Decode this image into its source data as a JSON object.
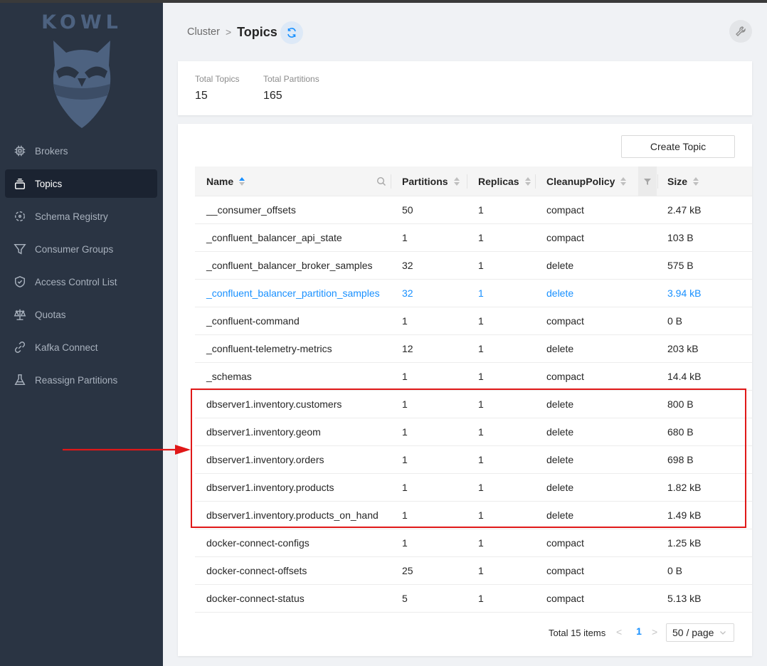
{
  "app": {
    "logo_text": "KOWL"
  },
  "sidebar": {
    "items": [
      {
        "label": "Brokers",
        "icon": "cpu-chip-icon"
      },
      {
        "label": "Topics",
        "icon": "stack-icon",
        "active": true
      },
      {
        "label": "Schema Registry",
        "icon": "schema-circle-icon"
      },
      {
        "label": "Consumer Groups",
        "icon": "funnel-icon"
      },
      {
        "label": "Access Control List",
        "icon": "shield-icon"
      },
      {
        "label": "Quotas",
        "icon": "scale-icon"
      },
      {
        "label": "Kafka Connect",
        "icon": "link-icon"
      },
      {
        "label": "Reassign Partitions",
        "icon": "flask-icon"
      }
    ]
  },
  "header": {
    "breadcrumb_parent": "Cluster",
    "breadcrumb_separator": ">",
    "title": "Topics"
  },
  "stats": {
    "total_topics_label": "Total Topics",
    "total_topics_value": "15",
    "total_partitions_label": "Total Partitions",
    "total_partitions_value": "165"
  },
  "toolbar": {
    "create_topic_label": "Create Topic"
  },
  "table": {
    "columns": {
      "name": "Name",
      "partitions": "Partitions",
      "replicas": "Replicas",
      "cleanup_policy": "CleanupPolicy",
      "size": "Size"
    },
    "rows": [
      {
        "name": "__consumer_offsets",
        "partitions": "50",
        "replicas": "1",
        "policy": "compact",
        "size": "2.47 kB"
      },
      {
        "name": "_confluent_balancer_api_state",
        "partitions": "1",
        "replicas": "1",
        "policy": "compact",
        "size": "103 B"
      },
      {
        "name": "_confluent_balancer_broker_samples",
        "partitions": "32",
        "replicas": "1",
        "policy": "delete",
        "size": "575 B"
      },
      {
        "name": "_confluent_balancer_partition_samples",
        "partitions": "32",
        "replicas": "1",
        "policy": "delete",
        "size": "3.94 kB",
        "hovered": true
      },
      {
        "name": "_confluent-command",
        "partitions": "1",
        "replicas": "1",
        "policy": "compact",
        "size": "0 B"
      },
      {
        "name": "_confluent-telemetry-metrics",
        "partitions": "12",
        "replicas": "1",
        "policy": "delete",
        "size": "203 kB"
      },
      {
        "name": "_schemas",
        "partitions": "1",
        "replicas": "1",
        "policy": "compact",
        "size": "14.4 kB"
      },
      {
        "name": "dbserver1.inventory.customers",
        "partitions": "1",
        "replicas": "1",
        "policy": "delete",
        "size": "800 B"
      },
      {
        "name": "dbserver1.inventory.geom",
        "partitions": "1",
        "replicas": "1",
        "policy": "delete",
        "size": "680 B"
      },
      {
        "name": "dbserver1.inventory.orders",
        "partitions": "1",
        "replicas": "1",
        "policy": "delete",
        "size": "698 B"
      },
      {
        "name": "dbserver1.inventory.products",
        "partitions": "1",
        "replicas": "1",
        "policy": "delete",
        "size": "1.82 kB"
      },
      {
        "name": "dbserver1.inventory.products_on_hand",
        "partitions": "1",
        "replicas": "1",
        "policy": "delete",
        "size": "1.49 kB"
      },
      {
        "name": "docker-connect-configs",
        "partitions": "1",
        "replicas": "1",
        "policy": "compact",
        "size": "1.25 kB"
      },
      {
        "name": "docker-connect-offsets",
        "partitions": "25",
        "replicas": "1",
        "policy": "compact",
        "size": "0 B"
      },
      {
        "name": "docker-connect-status",
        "partitions": "5",
        "replicas": "1",
        "policy": "compact",
        "size": "5.13 kB"
      }
    ]
  },
  "pagination": {
    "total_text": "Total 15 items",
    "prev": "<",
    "current_page": "1",
    "next": ">",
    "page_size": "50 / page"
  },
  "colors": {
    "sidebar_bg": "#2a3443",
    "accent": "#1890ff",
    "annotation_red": "#e01818"
  }
}
